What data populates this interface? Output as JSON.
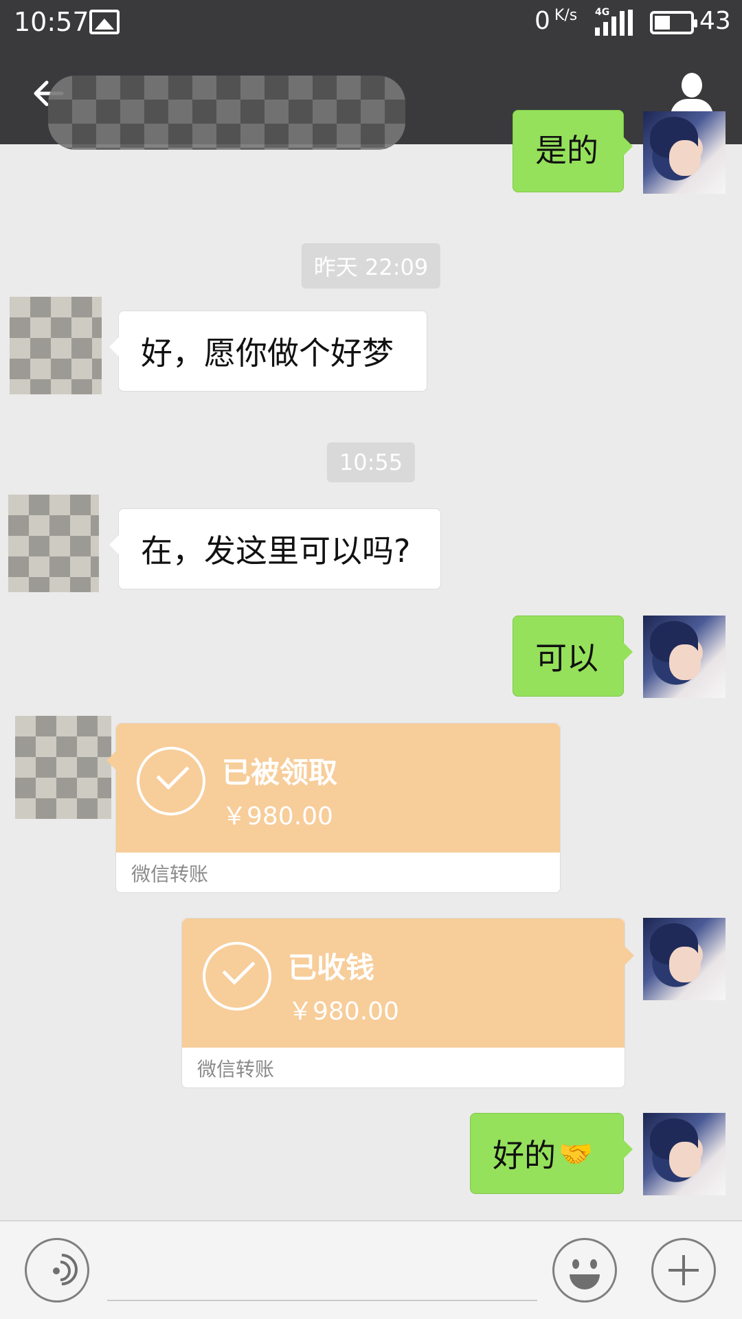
{
  "status_bar": {
    "time": "10:57",
    "network_speed": "0",
    "network_speed_unit": "K/s",
    "network_type": "4G",
    "battery": "43",
    "battery_level": 0.43
  },
  "header": {
    "contact_name": ""
  },
  "messages": [
    {
      "from": "self",
      "text": "是的"
    },
    {
      "type": "timestamp",
      "text": "昨天 22:09"
    },
    {
      "from": "other",
      "text": "好，愿你做个好梦"
    },
    {
      "type": "timestamp",
      "text": "10:55"
    },
    {
      "from": "other",
      "text": "在，发这里可以吗?"
    },
    {
      "from": "self",
      "text": "可以"
    },
    {
      "from": "other",
      "type": "transfer",
      "status": "已被领取",
      "amount": "￥980.00",
      "footer": "微信转账"
    },
    {
      "from": "self",
      "type": "transfer",
      "status": "已收钱",
      "amount": "￥980.00",
      "footer": "微信转账"
    },
    {
      "from": "self",
      "text": "好的",
      "emoji": "🤝"
    }
  ],
  "icons": {
    "back": "back-arrow-icon",
    "contact": "person-icon",
    "voice": "voice-icon",
    "emoji": "smiley-icon",
    "more": "plus-icon"
  },
  "colors": {
    "header_bg": "#3a3a3c",
    "self_bubble": "#95e15b",
    "transfer_card": "#f7cd9a"
  }
}
